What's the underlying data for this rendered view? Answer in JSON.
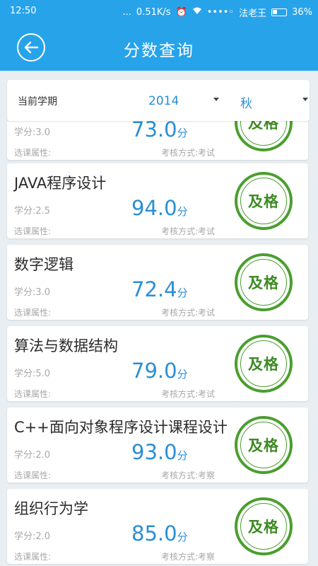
{
  "status_bar": {
    "time": "12:50",
    "dots": "...",
    "network_speed": "0.51K/s",
    "signal": "••••◦",
    "carrier": "法老王",
    "battery": "36%"
  },
  "header": {
    "title": "分数查询",
    "back_icon": "back-arrow-icon",
    "color": "#27a3ea"
  },
  "term_selector": {
    "label": "当前学期",
    "year": "2014",
    "season": "秋"
  },
  "courses": [
    {
      "name": "",
      "credit": "学分:3.0",
      "attribute": "选课属性:",
      "exam_method": "考核方式:考试",
      "score": "73.0",
      "unit": "分",
      "grade": "及格"
    },
    {
      "name": "JAVA程序设计",
      "credit": "学分:2.5",
      "attribute": "选课属性:",
      "exam_method": "考核方式:考试",
      "score": "94.0",
      "unit": "分",
      "grade": "及格"
    },
    {
      "name": "数字逻辑",
      "credit": "学分:3.0",
      "attribute": "选课属性:",
      "exam_method": "考核方式:考试",
      "score": "72.4",
      "unit": "分",
      "grade": "及格"
    },
    {
      "name": "算法与数据结构",
      "credit": "学分:5.0",
      "attribute": "选课属性:",
      "exam_method": "考核方式:考试",
      "score": "79.0",
      "unit": "分",
      "grade": "及格"
    },
    {
      "name": "C++面向对象程序设计课程设计",
      "credit": "学分:2.0",
      "attribute": "选课属性:",
      "exam_method": "考核方式:考察",
      "score": "93.0",
      "unit": "分",
      "grade": "及格"
    },
    {
      "name": "组织行为学",
      "credit": "学分:2.0",
      "attribute": "选课属性:",
      "exam_method": "考核方式:考察",
      "score": "85.0",
      "unit": "分",
      "grade": "及格"
    }
  ]
}
